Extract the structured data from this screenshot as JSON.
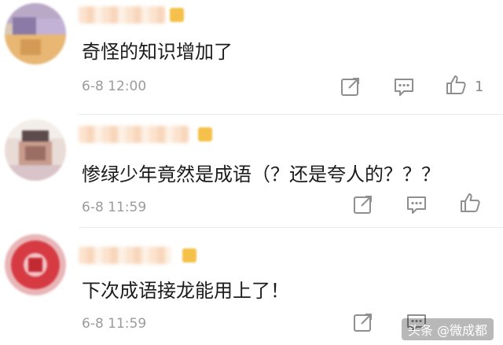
{
  "comments": [
    {
      "content": "奇怪的知识增加了",
      "time": "6-8 12:00",
      "like_count": "1",
      "has_vip_badge": true,
      "icons": [
        "share-icon",
        "comment-icon",
        "like-icon"
      ]
    },
    {
      "content": "惨绿少年竟然是成语（？还是夸人的？？？",
      "time": "6-8 11:59",
      "like_count": "",
      "has_vip_badge": true,
      "icons": [
        "share-icon",
        "comment-icon",
        "like-icon"
      ]
    },
    {
      "content": "下次成语接龙能用上了！",
      "time": "6-8 11:59",
      "like_count": "",
      "has_vip_badge": true,
      "icons": [
        "share-icon",
        "comment-icon"
      ]
    }
  ],
  "watermark": "头条 @微成都",
  "colors": {
    "text": "#1b1b1b",
    "time": "#9b9b9b",
    "icon": "#8f8f8f",
    "badge": "#f5c14a"
  }
}
